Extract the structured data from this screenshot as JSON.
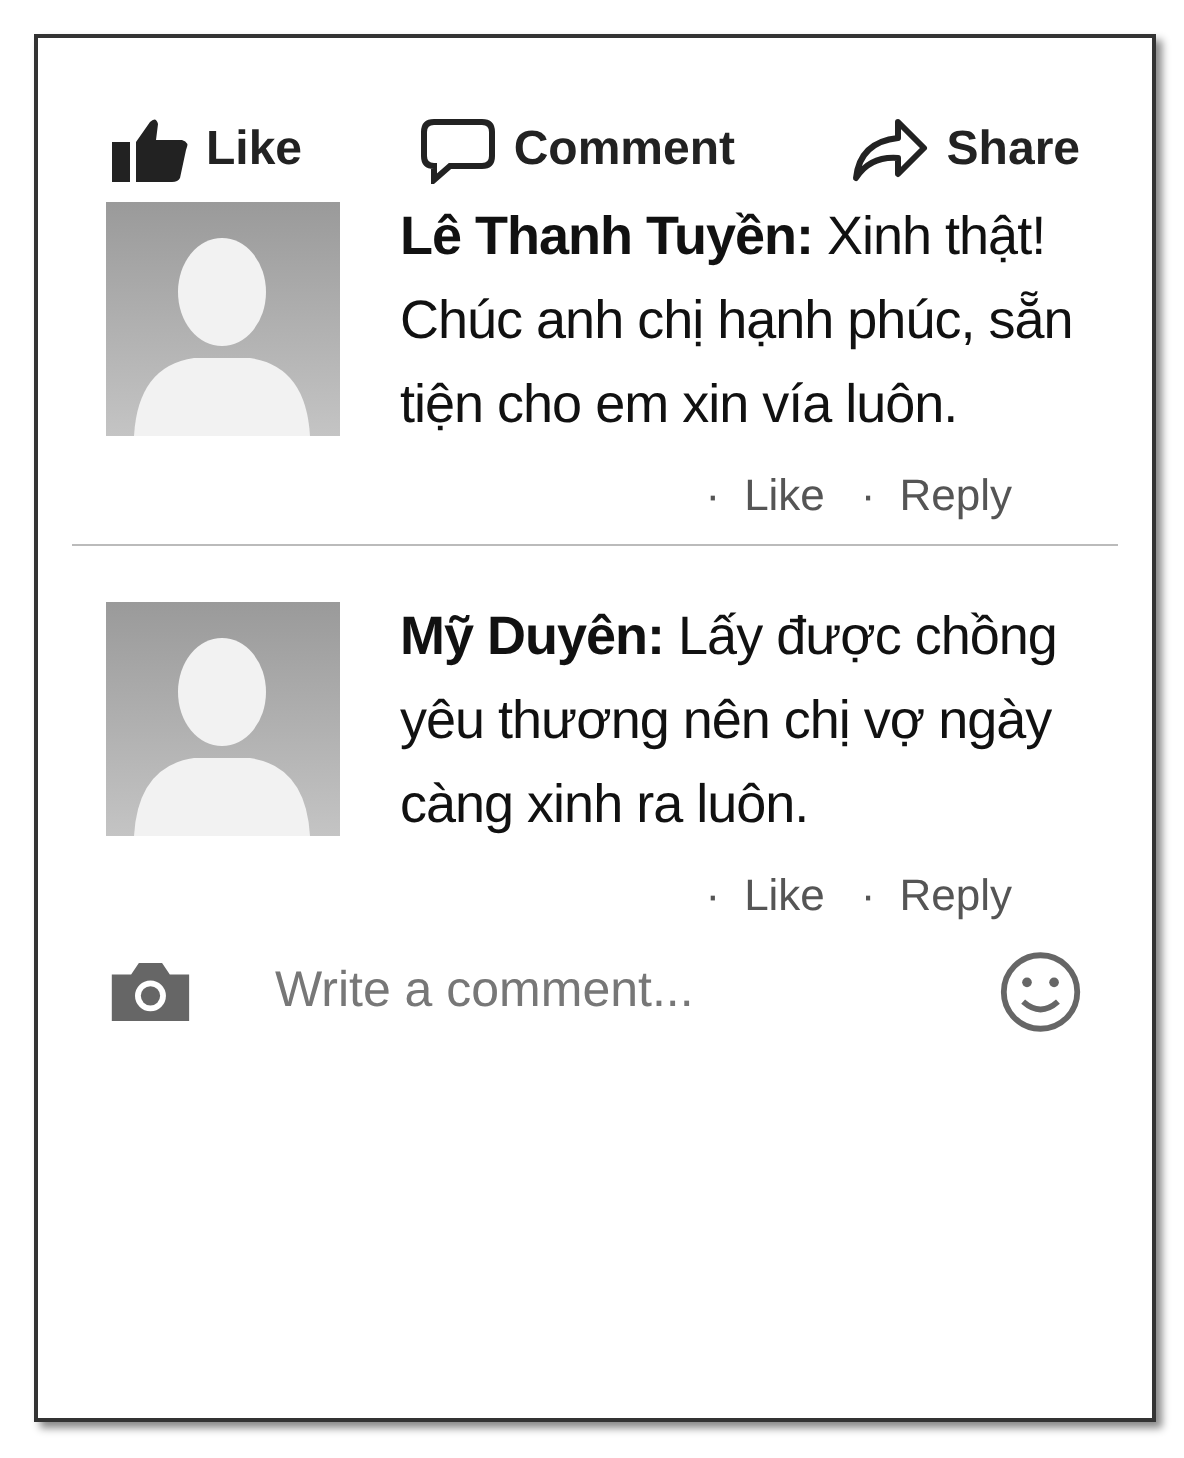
{
  "actions": [
    {
      "kind": "like",
      "label": "Like"
    },
    {
      "kind": "comment",
      "label": "Comment"
    },
    {
      "kind": "share",
      "label": "Share"
    }
  ],
  "comments": [
    {
      "text": "**Lê Thanh Tuyền:** Xinh thật! Chúc anh chị hạnh phúc, sẵn tiện cho em xin vía luôn.",
      "links": [
        {
          "separator": "·",
          "label": "Like"
        },
        {
          "separator": "·",
          "label": "Reply"
        }
      ]
    },
    {
      "text": "**Mỹ Duyên:** Lấy được chồng yêu thương nên chị vợ ngày càng xinh ra luôn.",
      "links": [
        {
          "separator": "·",
          "label": "Like"
        },
        {
          "separator": "·",
          "label": "Reply"
        }
      ]
    }
  ],
  "composer": {
    "placeholder": "Write a comment..."
  }
}
